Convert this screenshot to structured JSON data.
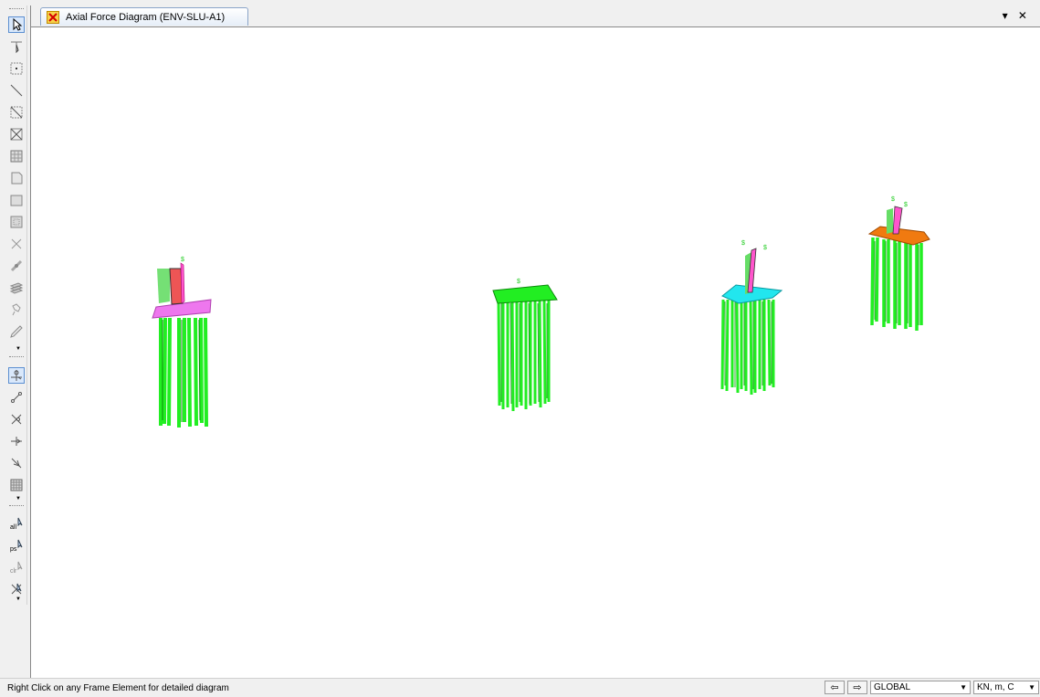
{
  "tab": {
    "title": "Axial Force Diagram (ENV-SLU-A1)",
    "controls": "▾ ✕"
  },
  "status": {
    "message": "Right Click on any Frame Element for detailed diagram",
    "coordinate_system": "GLOBAL",
    "units": "KN, m, C"
  },
  "toolbar": {
    "tools": [
      "pointer-select",
      "reshape",
      "point",
      "line",
      "window-select",
      "intersect",
      "panel",
      "area",
      "rectangle",
      "grid-select",
      "clear",
      "joint-select",
      "layer",
      "link",
      "pencil",
      "local-axes",
      "node-chain",
      "cross",
      "frame-snap",
      "diagonal",
      "grid-view",
      "select-all",
      "previous-selection",
      "clear-selection",
      "invert-selection"
    ],
    "all_label": "all",
    "ps_label": "ps",
    "clr_label": "clr"
  },
  "colors": {
    "pile": "#22ee22",
    "cap_magenta": "#ee77ee",
    "cap_green": "#22ee22",
    "cap_cyan": "#22e6ee",
    "cap_orange": "#f07a10",
    "column_red": "#ee5555",
    "column_pink": "#ff55cc"
  }
}
